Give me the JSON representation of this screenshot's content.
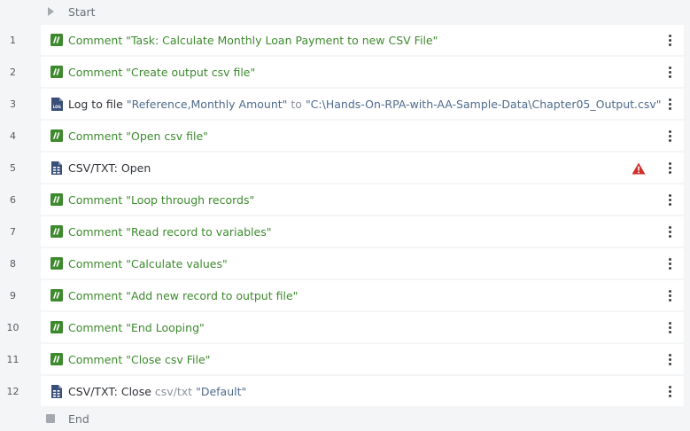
{
  "start_label": "Start",
  "end_label": "End",
  "actions": [
    {
      "num": "1",
      "icon": "comment-icon",
      "kind": "Comment",
      "parts": [
        {
          "t": "\"Task: Calculate Monthly Loan Payment to new CSV File\"",
          "c": "g"
        }
      ]
    },
    {
      "num": "2",
      "icon": "comment-icon",
      "kind": "Comment",
      "parts": [
        {
          "t": "\"Create output csv file\"",
          "c": "g"
        }
      ]
    },
    {
      "num": "3",
      "icon": "log-file-icon",
      "kind": "Log to file",
      "parts": [
        {
          "t": "\"Reference,Monthly Amount\"",
          "c": "v"
        },
        {
          "t": "to",
          "c": "m"
        },
        {
          "t": "\"C:\\Hands-On-RPA-with-AA-Sample-Data\\Chapter05_Output.csv\"",
          "c": "v"
        }
      ]
    },
    {
      "num": "4",
      "icon": "comment-icon",
      "kind": "Comment",
      "parts": [
        {
          "t": "\"Open csv file\"",
          "c": "g"
        }
      ]
    },
    {
      "num": "5",
      "icon": "csv-file-icon",
      "kind": "CSV/TXT: Open",
      "parts": [],
      "warning": true
    },
    {
      "num": "6",
      "icon": "comment-icon",
      "kind": "Comment",
      "parts": [
        {
          "t": "\"Loop through records\"",
          "c": "g"
        }
      ]
    },
    {
      "num": "7",
      "icon": "comment-icon",
      "kind": "Comment",
      "parts": [
        {
          "t": "\"Read record to variables\"",
          "c": "g"
        }
      ]
    },
    {
      "num": "8",
      "icon": "comment-icon",
      "kind": "Comment",
      "parts": [
        {
          "t": "\"Calculate values\"",
          "c": "g"
        }
      ]
    },
    {
      "num": "9",
      "icon": "comment-icon",
      "kind": "Comment",
      "parts": [
        {
          "t": "\"Add new record to output file\"",
          "c": "g"
        }
      ]
    },
    {
      "num": "10",
      "icon": "comment-icon",
      "kind": "Comment",
      "parts": [
        {
          "t": "\"End Looping\"",
          "c": "g"
        }
      ]
    },
    {
      "num": "11",
      "icon": "comment-icon",
      "kind": "Comment",
      "parts": [
        {
          "t": "\"Close csv File\"",
          "c": "g"
        }
      ]
    },
    {
      "num": "12",
      "icon": "csv-file-icon",
      "kind": "CSV/TXT: Close",
      "parts": [
        {
          "t": "csv/txt",
          "c": "m"
        },
        {
          "t": "\"Default\"",
          "c": "v"
        }
      ]
    }
  ],
  "colors": {
    "comment": "#3d8a2e",
    "value": "#4f6b8c",
    "warning": "#d0302c",
    "icon_blue": "#3a4f78"
  }
}
